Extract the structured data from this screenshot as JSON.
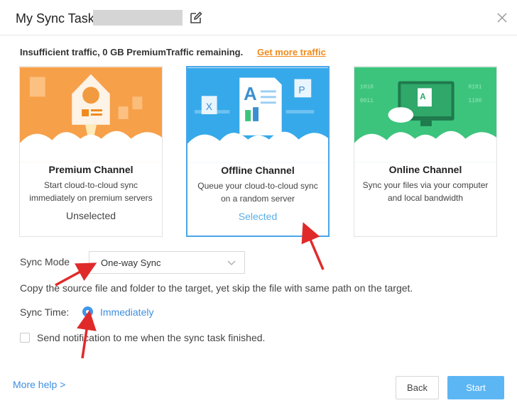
{
  "header": {
    "title": "My Sync Task",
    "icons": [
      "edit-icon",
      "close-icon"
    ]
  },
  "notice": {
    "text": "Insufficient traffic, 0 GB PremiumTraffic remaining.",
    "link": "Get more traffic"
  },
  "channels": [
    {
      "title": "Premium Channel",
      "description": "Start cloud-to-cloud sync immediately on premium servers",
      "status": "Unselected",
      "selected": false,
      "color": "#f7a04a"
    },
    {
      "title": "Offline Channel",
      "description": "Queue your cloud-to-cloud sync on a random server",
      "status": "Selected",
      "selected": true,
      "color": "#36a9ea"
    },
    {
      "title": "Online Channel",
      "description": "Sync your files via your computer and local bandwidth",
      "status": "",
      "selected": false,
      "color": "#3cc47c"
    }
  ],
  "sync_mode": {
    "label": "Sync Mode",
    "value": "One-way Sync",
    "description": "Copy the source file and folder to the target, yet skip the file with same path on the target."
  },
  "sync_time": {
    "label": "Sync Time:",
    "option": "Immediately",
    "checked": true
  },
  "notification": {
    "label": "Send notification to me when the sync task finished.",
    "checked": false
  },
  "footer": {
    "help": "More help >",
    "back": "Back",
    "start": "Start"
  },
  "colors": {
    "accent": "#3f96ea",
    "orange_link": "#f08a1c",
    "start_button": "#5db6f4",
    "annotation_arrow": "#e02a2a"
  }
}
